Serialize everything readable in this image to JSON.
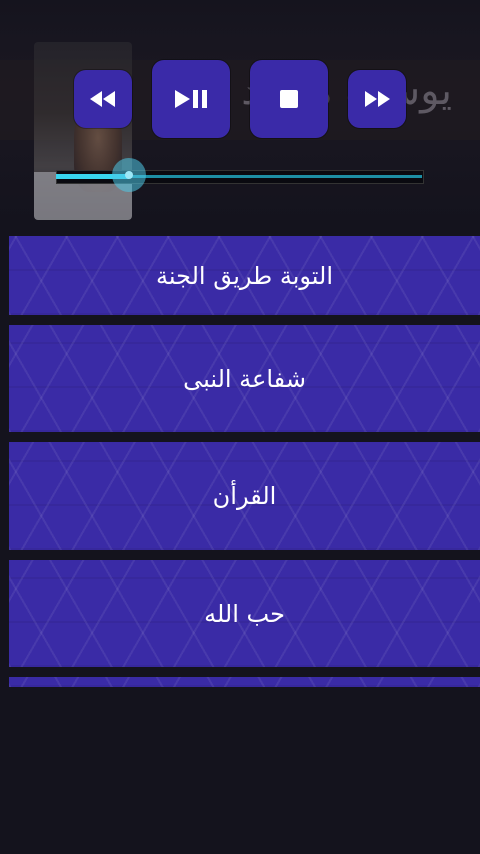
{
  "header": {
    "title": "يوسف محمد",
    "avatar_icon": "person-photo-icon"
  },
  "controls": {
    "rewind_icon": "rewind-icon",
    "play_pause_icon": "play-pause-icon",
    "stop_icon": "stop-icon",
    "fast_forward_icon": "fast-forward-icon",
    "accent": "#3a2aa8"
  },
  "seekbar": {
    "progress": 0.2,
    "color": "#39d6ef"
  },
  "list": {
    "items": [
      {
        "label": "التوبة طريق الجنة"
      },
      {
        "label": "شفاعة النبى"
      },
      {
        "label": "القرأن"
      },
      {
        "label": "حب الله"
      }
    ]
  }
}
